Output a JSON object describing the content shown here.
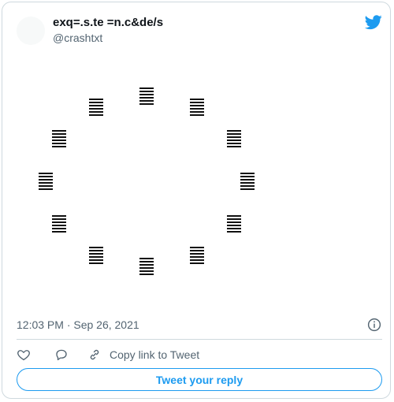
{
  "tweet": {
    "display_name": "exq=.s.te =n.c&de/s",
    "handle": "@crashtxt",
    "art_glyph_count": 12,
    "timestamp": "12:03 PM · Sep 26, 2021"
  },
  "actions": {
    "copy_link_label": "Copy link to Tweet",
    "reply_button_label": "Tweet your reply"
  },
  "colors": {
    "accent": "#1d9bf0",
    "muted_text": "#536471",
    "border": "#cfd9de"
  },
  "icons": [
    "twitter-bird-icon",
    "info-icon",
    "heart-icon",
    "reply-icon",
    "link-icon"
  ]
}
